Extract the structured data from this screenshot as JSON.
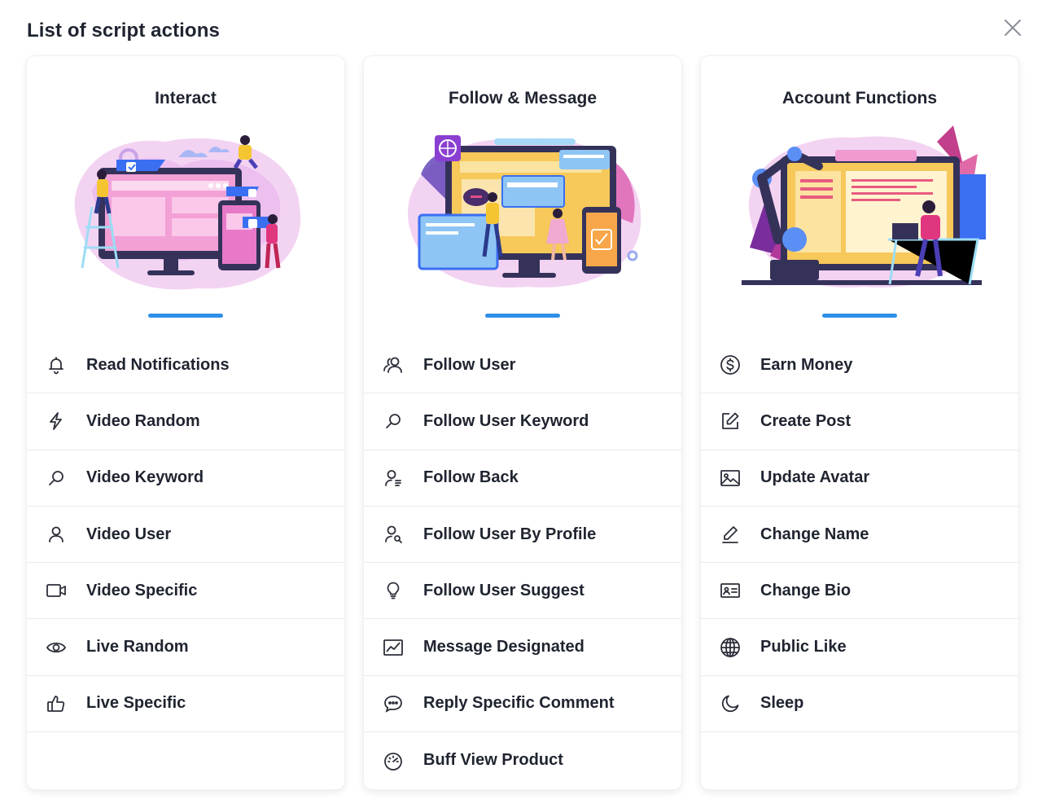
{
  "dialog": {
    "title": "List of script actions"
  },
  "colors": {
    "accent": "#2d8fe6",
    "text": "#1f2430",
    "divider": "#e9ebef"
  },
  "columns": [
    {
      "title": "Interact",
      "items": [
        {
          "label": "Read Notifications",
          "icon": "bell-icon"
        },
        {
          "label": "Video Random",
          "icon": "lightning-icon"
        },
        {
          "label": "Video Keyword",
          "icon": "search-icon"
        },
        {
          "label": "Video User",
          "icon": "user-icon"
        },
        {
          "label": "Video Specific",
          "icon": "video-camera-icon"
        },
        {
          "label": "Live Random",
          "icon": "eye-icon"
        },
        {
          "label": "Live Specific",
          "icon": "thumbs-up-icon"
        }
      ]
    },
    {
      "title": "Follow & Message",
      "items": [
        {
          "label": "Follow User",
          "icon": "users-icon"
        },
        {
          "label": "Follow User Keyword",
          "icon": "search-icon"
        },
        {
          "label": "Follow Back",
          "icon": "user-list-icon"
        },
        {
          "label": "Follow User By Profile",
          "icon": "user-search-icon"
        },
        {
          "label": "Follow User Suggest",
          "icon": "lightbulb-icon"
        },
        {
          "label": "Message Designated",
          "icon": "chart-line-icon"
        },
        {
          "label": "Reply Specific Comment",
          "icon": "chat-icon"
        },
        {
          "label": "Buff View Product",
          "icon": "speedometer-icon"
        }
      ]
    },
    {
      "title": "Account Functions",
      "items": [
        {
          "label": "Earn Money",
          "icon": "dollar-icon"
        },
        {
          "label": "Create Post",
          "icon": "edit-icon"
        },
        {
          "label": "Update Avatar",
          "icon": "image-icon"
        },
        {
          "label": "Change Name",
          "icon": "pen-icon"
        },
        {
          "label": "Change Bio",
          "icon": "id-card-icon"
        },
        {
          "label": "Public Like",
          "icon": "globe-icon"
        },
        {
          "label": "Sleep",
          "icon": "moon-icon"
        }
      ]
    }
  ]
}
